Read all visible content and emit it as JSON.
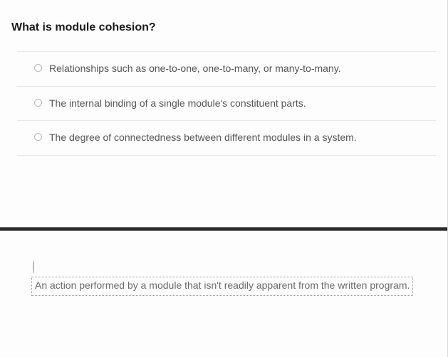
{
  "question1": {
    "title": "What is module cohesion?",
    "options": [
      "Relationships such as one-to-one, one-to-many, or many-to-many.",
      "The internal binding of a single module's constituent parts.",
      "The degree of connectedness between different modules in a system."
    ]
  },
  "question2": {
    "selected_option": "An action performed by a module that isn't readily apparent from the written program."
  }
}
